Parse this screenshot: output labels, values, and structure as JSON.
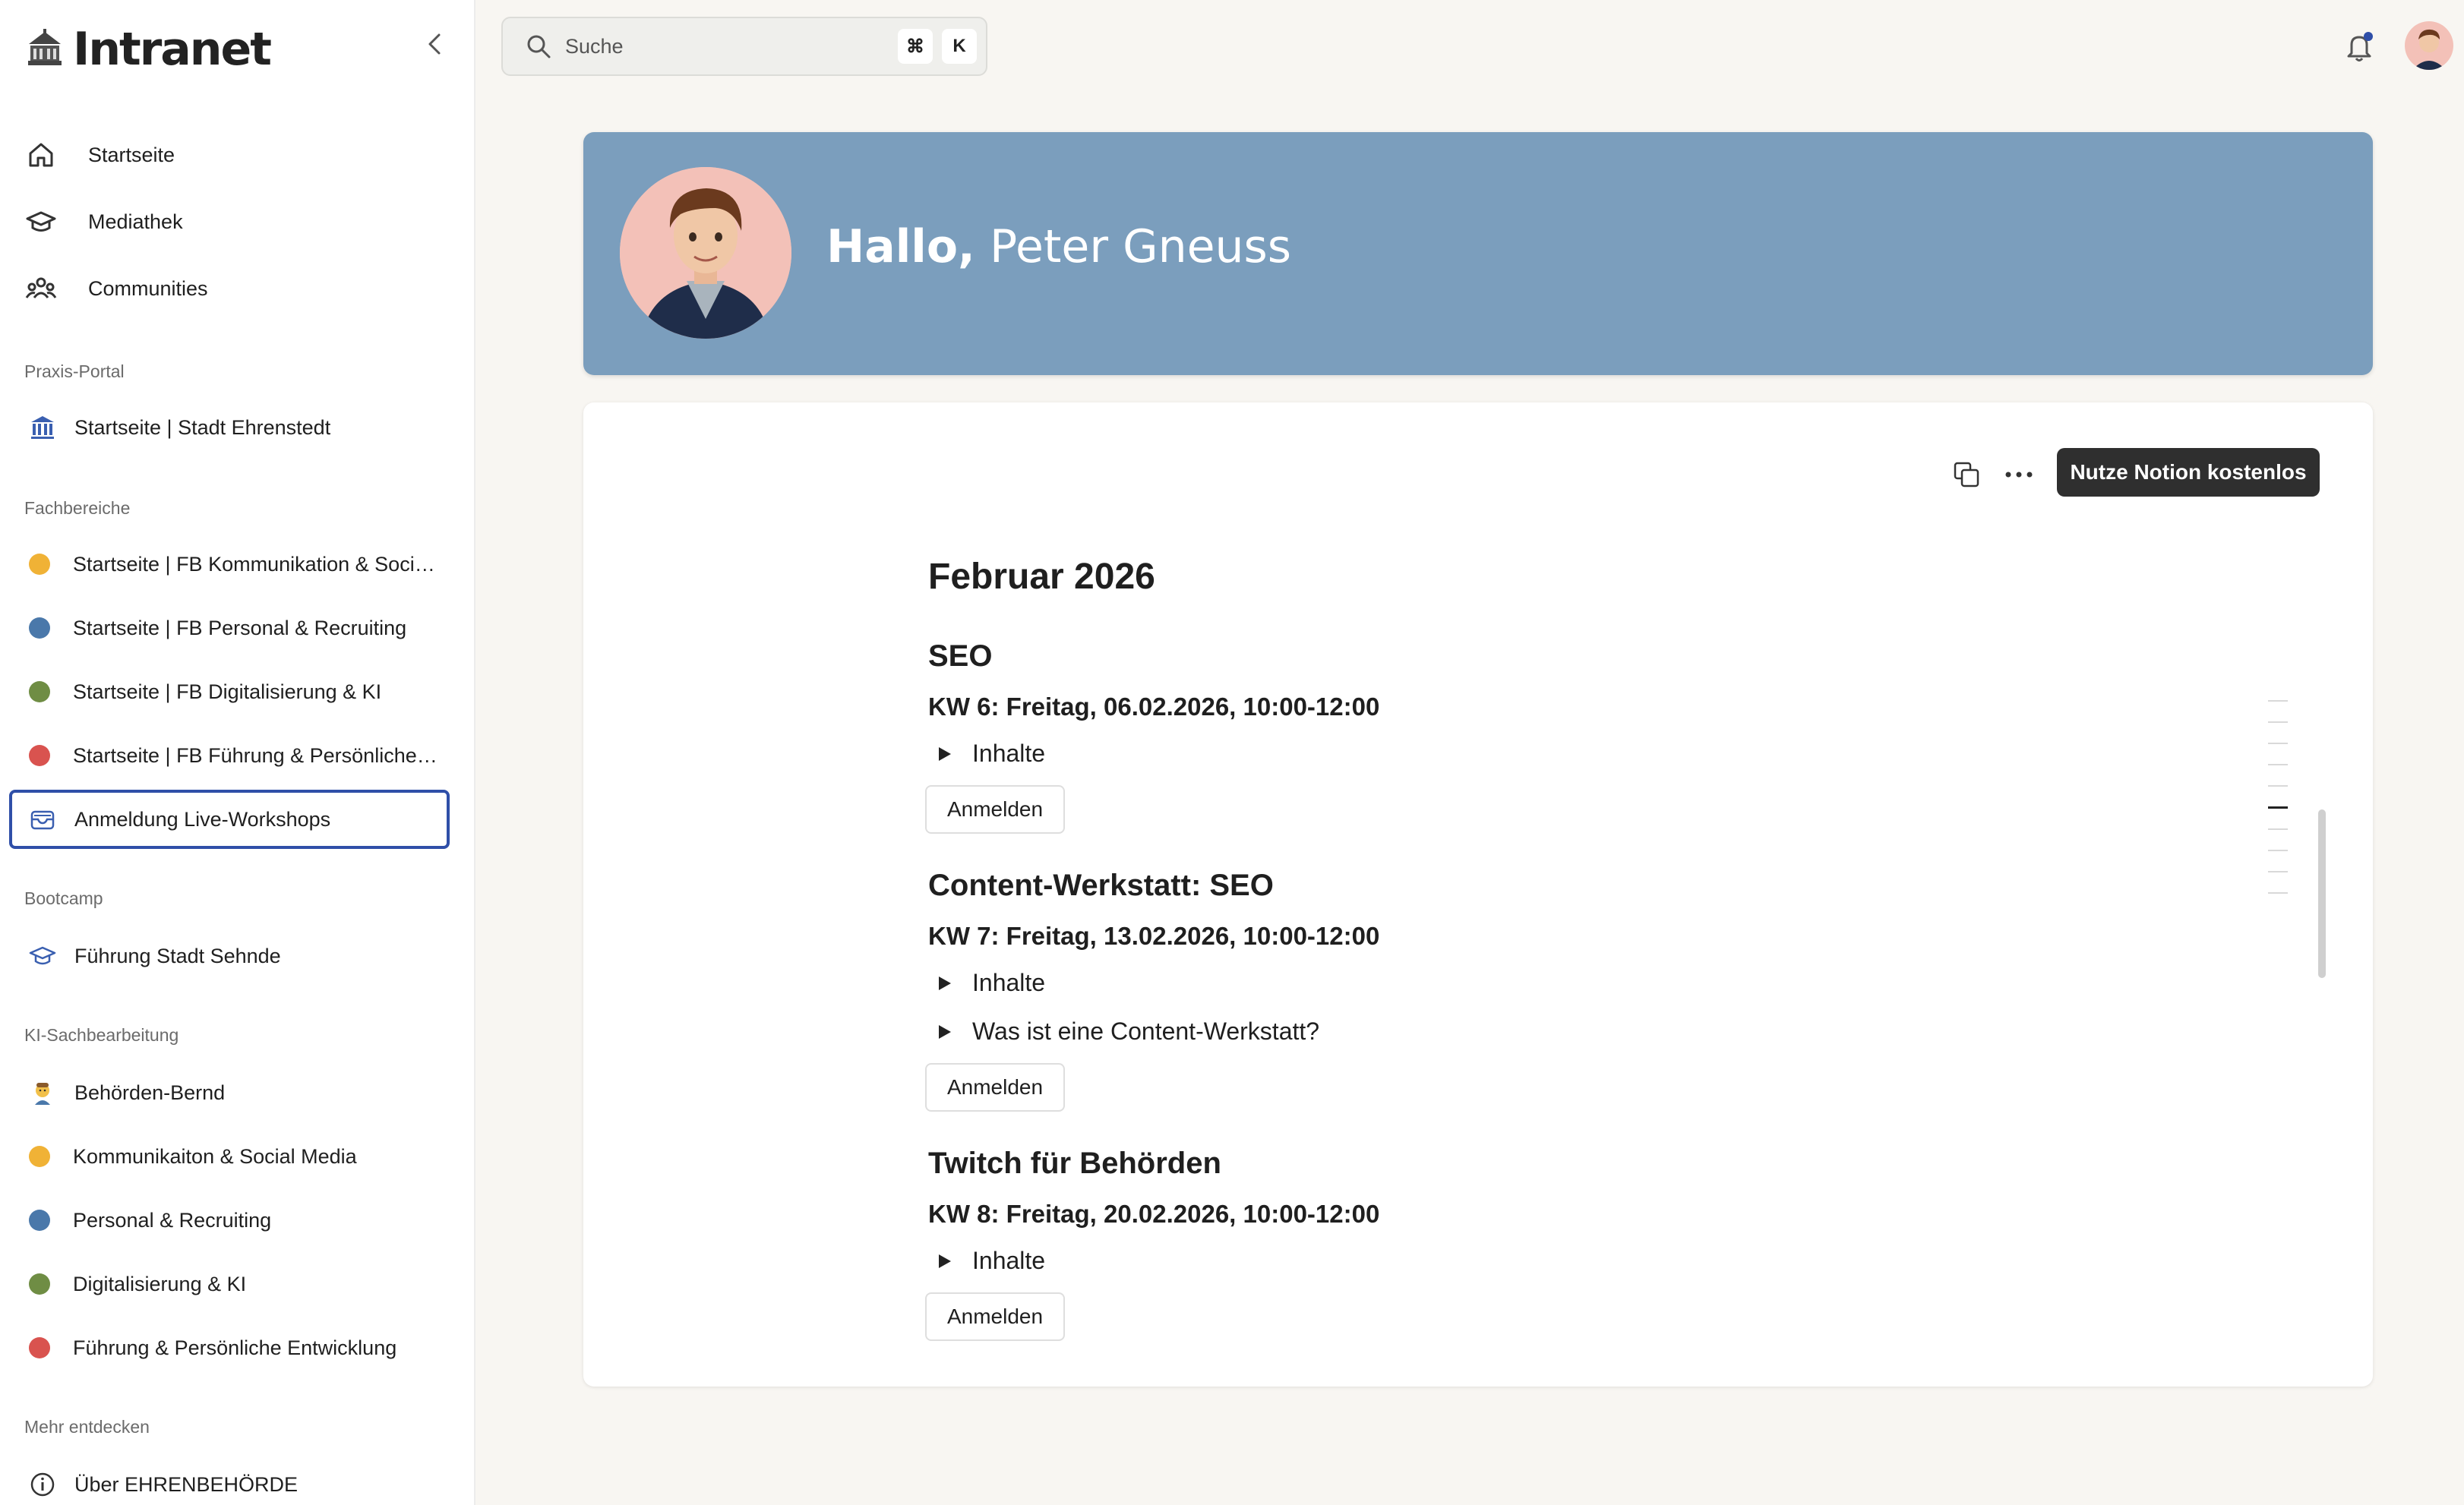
{
  "brand": {
    "name": "Intranet",
    "logo_icon": "city-hall-icon"
  },
  "sidebar": {
    "main_items": [
      {
        "label": "Startseite",
        "icon": "home-icon"
      },
      {
        "label": "Mediathek",
        "icon": "graduation-cap-icon"
      },
      {
        "label": "Communities",
        "icon": "people-icon"
      }
    ],
    "sections": [
      {
        "title": "Praxis-Portal"
      },
      {
        "title": "Fachbereiche"
      },
      {
        "title": "Bootcamp"
      },
      {
        "title": "KI-Sachbearbeitung"
      },
      {
        "title": "Mehr entdecken"
      }
    ],
    "praxis_items": [
      {
        "label": "Startseite | Stadt Ehrenstedt",
        "icon": "bank-building-icon"
      }
    ],
    "fach_items": [
      {
        "label": "Startseite | FB Kommunikation & Social Media",
        "color": "#f0b236"
      },
      {
        "label": "Startseite | FB Personal & Recruiting",
        "color": "#4a78aa"
      },
      {
        "label": "Startseite | FB Digitalisierung & KI",
        "color": "#6f8d44"
      },
      {
        "label": "Startseite | FB Führung & Persönliche Entwicklung",
        "color": "#d9534f"
      },
      {
        "label": "Anmeldung Live-Workshops",
        "icon": "inbox-tray-icon",
        "active": true
      }
    ],
    "bootcamp_items": [
      {
        "label": "Führung Stadt Sehnde",
        "icon": "graduation-cap-icon"
      }
    ],
    "ki_items": [
      {
        "label": "Behörden-Bernd",
        "icon": "person-emoji-icon"
      },
      {
        "label": "Kommunikaiton & Social Media",
        "color": "#f0b236"
      },
      {
        "label": "Personal & Recruiting",
        "color": "#4a78aa"
      },
      {
        "label": "Digitalisierung & KI",
        "color": "#6f8d44"
      },
      {
        "label": "Führung & Persönliche Entwicklung",
        "color": "#d9534f"
      }
    ],
    "more_items": [
      {
        "label": "Über EHRENBEHÖRDE",
        "icon": "info-icon"
      }
    ]
  },
  "topbar": {
    "search_placeholder": "Suche",
    "shortcut_cmd": "⌘",
    "shortcut_key": "K"
  },
  "hero": {
    "greeting_bold": "Hallo,",
    "name": "Peter Gneuss"
  },
  "card": {
    "notion_button": "Nutze Notion kostenlos",
    "month_heading": "Februar 2026",
    "events": [
      {
        "title": "SEO",
        "date": "KW 6: Freitag, 06.02.2026, 10:00-12:00",
        "toggles": [
          "Inhalte"
        ],
        "button": "Anmelden"
      },
      {
        "title": "Content-Werkstatt: SEO",
        "date": "KW 7: Freitag, 13.02.2026, 10:00-12:00",
        "toggles": [
          "Inhalte",
          "Was ist eine Content-Werkstatt?"
        ],
        "button": "Anmelden"
      },
      {
        "title": "Twitch für Behörden",
        "date": "KW 8: Freitag, 20.02.2026, 10:00-12:00",
        "toggles": [
          "Inhalte"
        ],
        "button": "Anmelden"
      }
    ]
  },
  "colors": {
    "accent_active": "#2f4fa8",
    "hero_bg": "#7b9ebd",
    "dark_button": "#2f2f2f"
  }
}
